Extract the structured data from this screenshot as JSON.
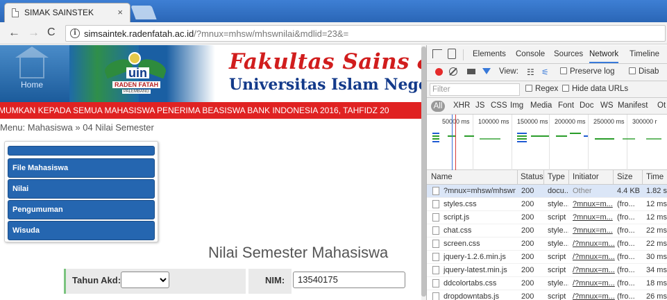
{
  "browser": {
    "tab_title": "SIMAK SAINSTEK",
    "tab_close": "×",
    "url_host": "simsaintek.radenfatah.ac.id",
    "url_path": "/?mnux=mhsw/mhswnilai&mdlid=23&="
  },
  "site": {
    "home_label": "Home",
    "logo_text": "uin",
    "logo_sub": "RADEN FATAH",
    "logo_sub2": "PALEMBANG",
    "faculty": "Fakultas Sains &",
    "university": "Universitas Islam Negeri R",
    "announcement": "MUMKAN KEPADA SEMUA MAHASISWA PENERIMA BEASISWA BANK INDONESIA 2016, TAHFIDZ 20",
    "breadcrumb": "Menu: Mahasiswa » 04 Nilai Semester",
    "menu": [
      "File Mahasiswa",
      "Nilai",
      "Pengumuman",
      "Wisuda"
    ],
    "page_title": "Nilai Semester Mahasiswa",
    "form": {
      "tahun_label": "Tahun Akd:",
      "tahun_value": "",
      "nim_label": "NIM:",
      "nim_value": "13540175"
    }
  },
  "devtools": {
    "tabs": [
      "Elements",
      "Console",
      "Sources",
      "Network",
      "Timeline"
    ],
    "active_tab": "Network",
    "toolbar": {
      "view_label": "View:",
      "preserve_log": "Preserve log",
      "disable_cache": "Disab"
    },
    "filter": {
      "placeholder": "Filter",
      "regex": "Regex",
      "hide_data_urls": "Hide data URLs"
    },
    "types": [
      "All",
      "XHR",
      "JS",
      "CSS",
      "Img",
      "Media",
      "Font",
      "Doc",
      "WS",
      "Manifest",
      "Ot"
    ],
    "timeline_ticks": [
      "50000 ms",
      "100000 ms",
      "150000 ms",
      "200000 ms",
      "250000 ms",
      "300000 r"
    ],
    "columns": [
      "Name",
      "Status",
      "Type",
      "Initiator",
      "Size",
      "Time"
    ],
    "requests": [
      {
        "name": "?mnux=mhsw/mhswn...",
        "status": "200",
        "type": "docu...",
        "initiator": "Other",
        "size": "4.4 KB",
        "time": "1.82 s",
        "selected": true
      },
      {
        "name": "styles.css",
        "status": "200",
        "type": "style...",
        "initiator": "?mnux=m...",
        "size": "(fro...",
        "time": "12 ms"
      },
      {
        "name": "script.js",
        "status": "200",
        "type": "script",
        "initiator": "?mnux=m...",
        "size": "(fro...",
        "time": "12 ms"
      },
      {
        "name": "chat.css",
        "status": "200",
        "type": "style...",
        "initiator": "?mnux=m...",
        "size": "(fro...",
        "time": "22 ms"
      },
      {
        "name": "screen.css",
        "status": "200",
        "type": "style...",
        "initiator": "/?mnux=m...",
        "size": "(fro...",
        "time": "22 ms"
      },
      {
        "name": "jquery-1.2.6.min.js",
        "status": "200",
        "type": "script",
        "initiator": "/?mnux=m...",
        "size": "(fro...",
        "time": "30 ms"
      },
      {
        "name": "jquery-latest.min.js",
        "status": "200",
        "type": "script",
        "initiator": "/?mnux=m...",
        "size": "(fro...",
        "time": "34 ms"
      },
      {
        "name": "ddcolortabs.css",
        "status": "200",
        "type": "style...",
        "initiator": "/?mnux=m...",
        "size": "(fro...",
        "time": "18 ms"
      },
      {
        "name": "dropdowntabs.js",
        "status": "200",
        "type": "script",
        "initiator": "/?mnux=m...",
        "size": "(fro...",
        "time": "26 ms"
      }
    ]
  }
}
